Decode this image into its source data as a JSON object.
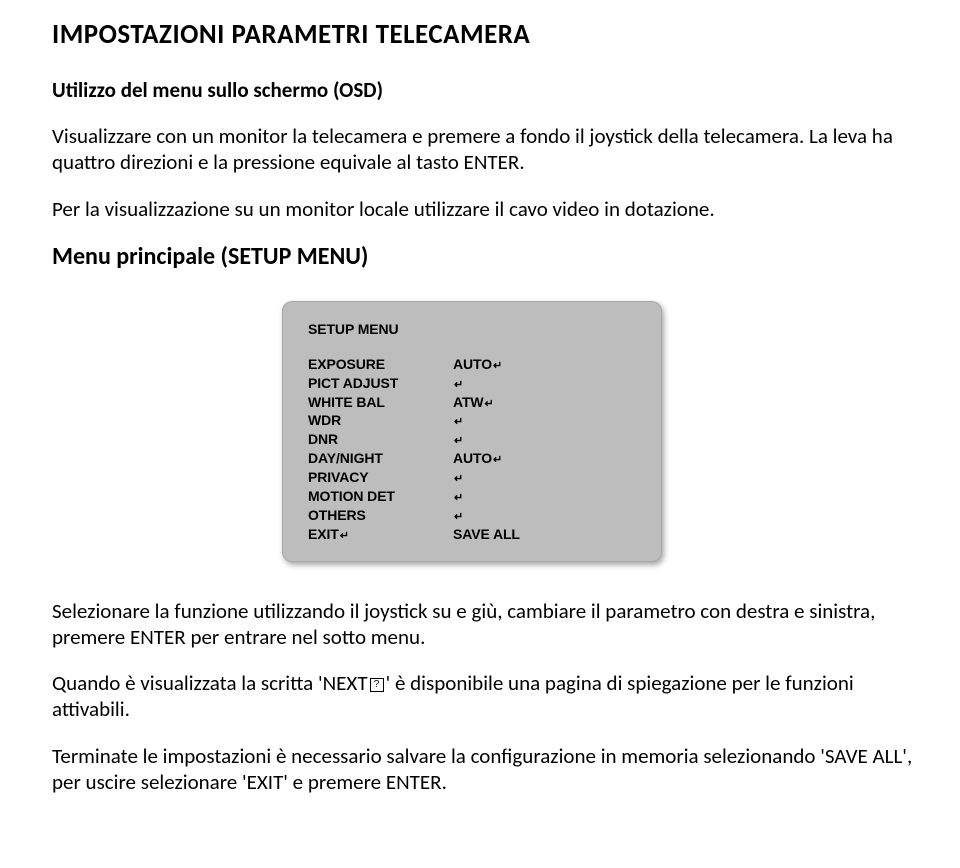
{
  "title": "IMPOSTAZIONI PARAMETRI TELECAMERA",
  "subtitle": "Utilizzo del menu sullo schermo (OSD)",
  "para1": "Visualizzare con un monitor la telecamera e premere a fondo il joystick della telecamera. La leva ha quattro direzioni e la pressione equivale al tasto ENTER.",
  "para2": "Per la visualizzazione su un monitor locale utilizzare il cavo video in dotazione.",
  "section_heading": "Menu principale (SETUP MENU)",
  "osd": {
    "title": "SETUP MENU",
    "rows": [
      {
        "label": "EXPOSURE",
        "value": "AUTO",
        "enter": true
      },
      {
        "label": "PICT ADJUST",
        "value": "",
        "enter": true
      },
      {
        "label": "WHITE BAL",
        "value": "ATW",
        "enter": true
      },
      {
        "label": "WDR",
        "value": "",
        "enter": true
      },
      {
        "label": "DNR",
        "value": "",
        "enter": true
      },
      {
        "label": "DAY/NIGHT",
        "value": "AUTO",
        "enter": true
      },
      {
        "label": "PRIVACY",
        "value": "",
        "enter": true
      },
      {
        "label": "MOTION DET",
        "value": "",
        "enter": true
      },
      {
        "label": "OTHERS",
        "value": "",
        "enter": true
      },
      {
        "label": "EXIT",
        "label_enter": true,
        "value": "SAVE ALL",
        "enter": false
      }
    ]
  },
  "para3": "Selezionare la funzione utilizzando il joystick su e giù, cambiare il parametro con destra e sinistra, premere ENTER per entrare nel sotto menu.",
  "para4_pre": "Quando è visualizzata la scritta 'NEXT",
  "para4_post": "' è disponibile una pagina di spiegazione per le funzioni attivabili.",
  "para5": "Terminate le impostazioni è necessario salvare la configurazione in memoria selezionando 'SAVE ALL', per uscire selezionare 'EXIT' e premere ENTER."
}
